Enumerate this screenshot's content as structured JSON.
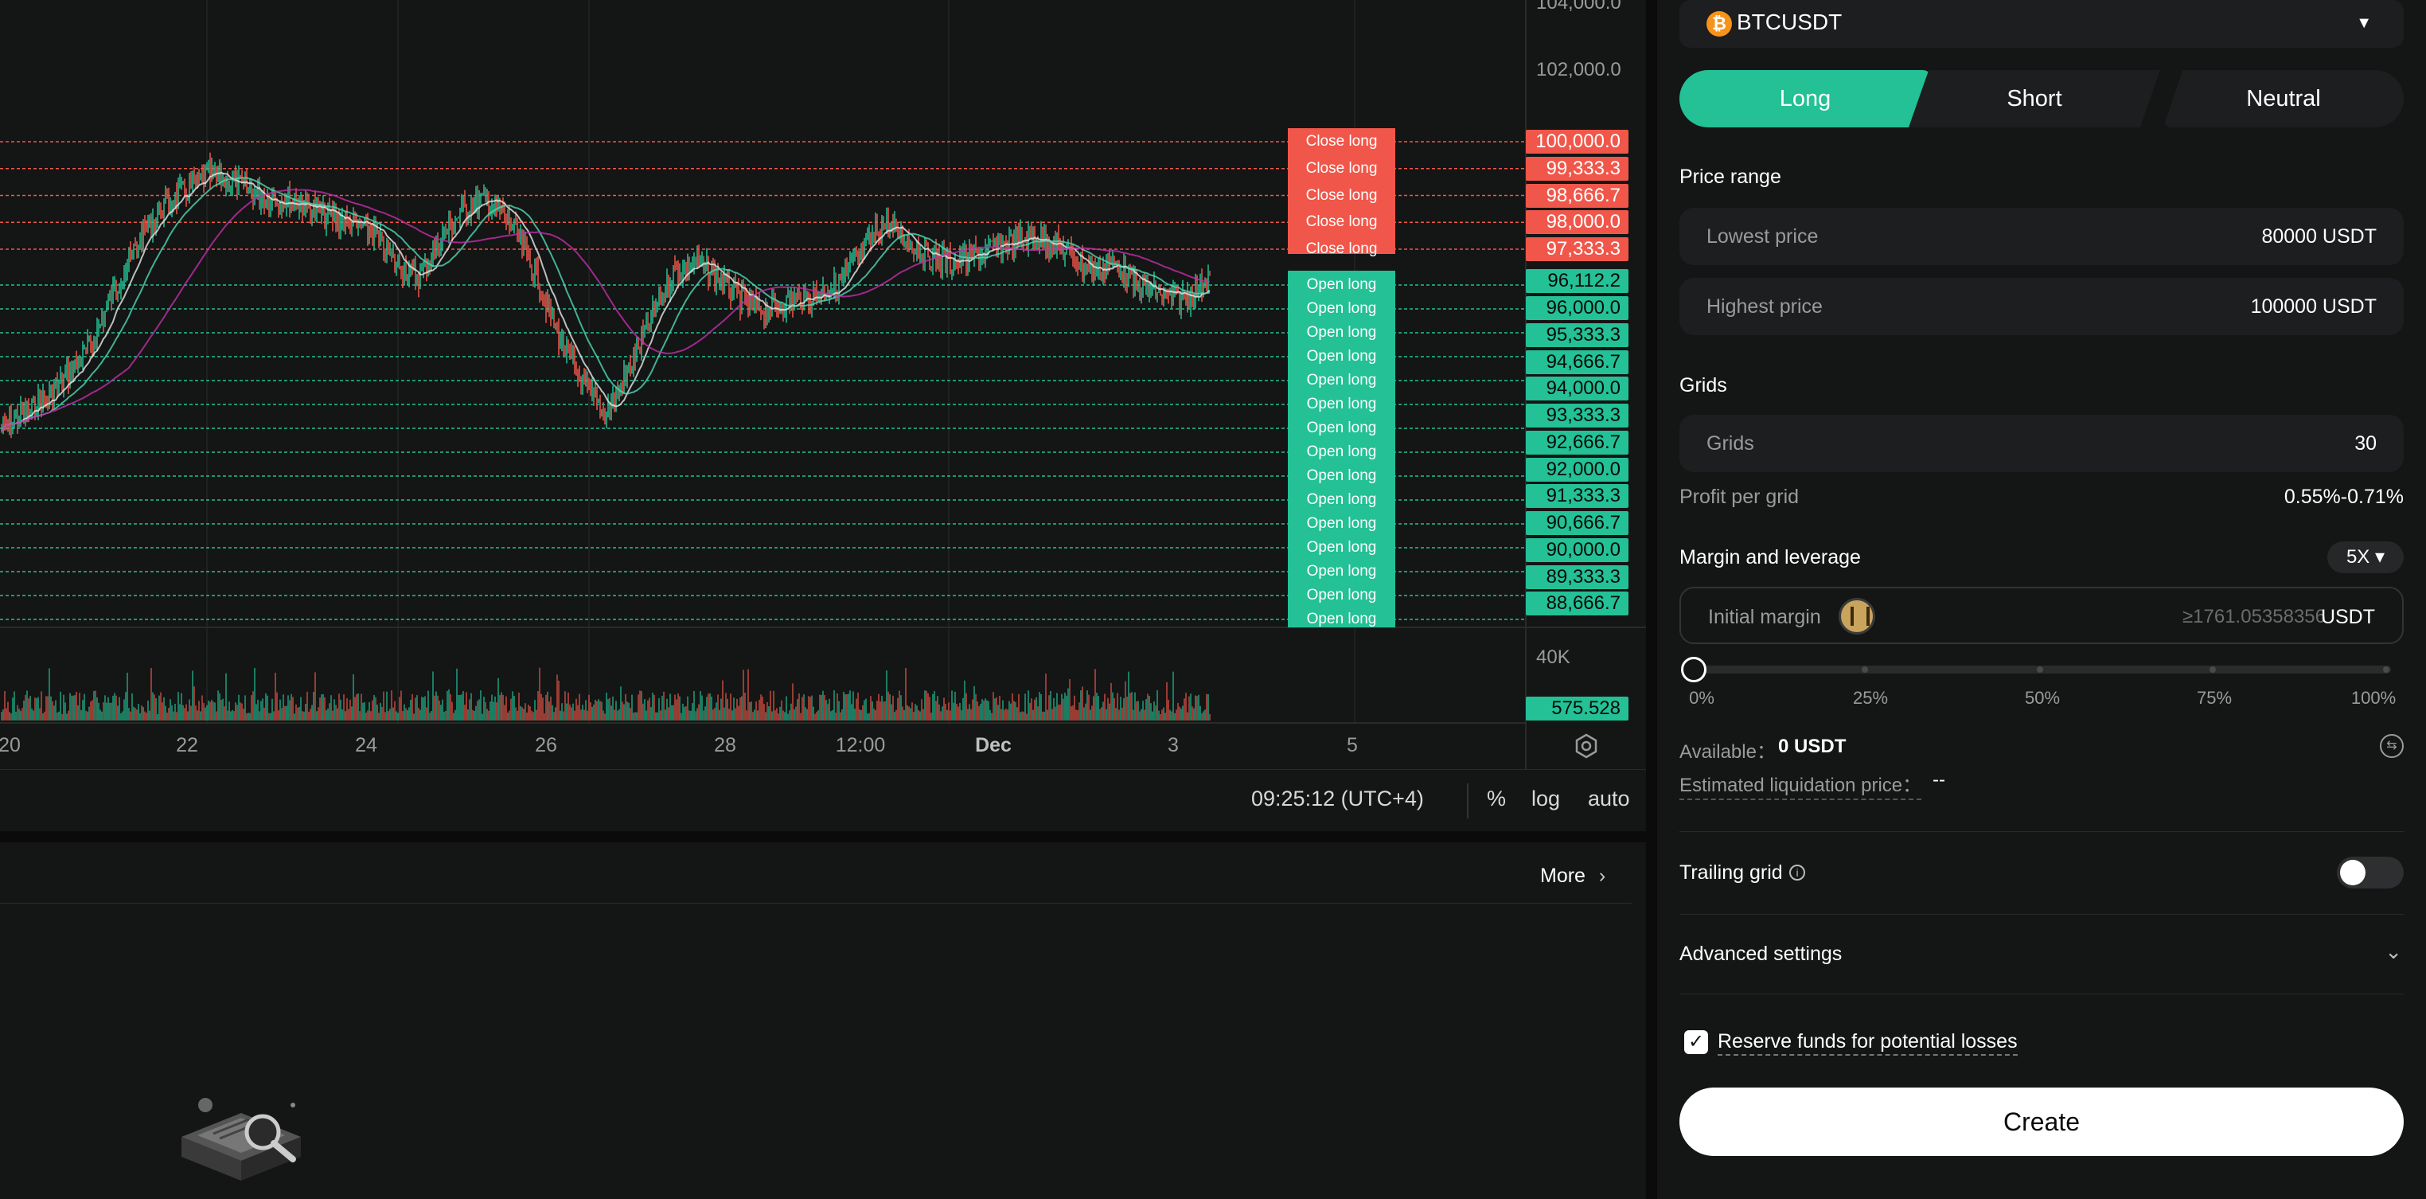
{
  "chart": {
    "price_axis": [
      "104,000.0",
      "102,000.0"
    ],
    "sell_orders": [
      {
        "label": "Close long",
        "price": "100,000.0"
      },
      {
        "label": "Close long",
        "price": "99,333.3"
      },
      {
        "label": "Close long",
        "price": "98,666.7"
      },
      {
        "label": "Close long",
        "price": "98,000.0"
      },
      {
        "label": "Close long",
        "price": "97,333.3"
      }
    ],
    "current_price": "96,112.2",
    "buy_orders": [
      {
        "label": "Open long",
        "price": "96,000.0"
      },
      {
        "label": "Open long",
        "price": "95,333.3"
      },
      {
        "label": "Open long",
        "price": "94,666.7"
      },
      {
        "label": "Open long",
        "price": "94,000.0"
      },
      {
        "label": "Open long",
        "price": "93,333.3"
      },
      {
        "label": "Open long",
        "price": "92,666.7"
      },
      {
        "label": "Open long",
        "price": "92,000.0"
      },
      {
        "label": "Open long",
        "price": "91,333.3"
      },
      {
        "label": "Open long",
        "price": "90,666.7"
      },
      {
        "label": "Open long",
        "price": "90,000.0"
      },
      {
        "label": "Open long",
        "price": "89,333.3"
      },
      {
        "label": "Open long",
        "price": "88,666.7"
      },
      {
        "label": "Open long",
        "price": ""
      },
      {
        "label": "Open long",
        "price": ""
      },
      {
        "label": "Open long",
        "price": ""
      }
    ],
    "volume_axis": "40K",
    "current_volume": "575.528",
    "x_labels": [
      "20",
      "22",
      "24",
      "26",
      "28",
      "12:00",
      "Dec",
      "3",
      "5"
    ],
    "time_readout": "09:25:12 (UTC+4)",
    "axis_options": [
      "%",
      "log",
      "auto"
    ],
    "colors": {
      "up": "#23c195",
      "down": "#f0574a",
      "ma_fast": "#e8e8e8",
      "ma_mid": "#4fd8b4",
      "ma_slow": "#c02fa8"
    }
  },
  "info_panel": {
    "more_label": "More"
  },
  "form": {
    "pair": "BTCUSDT",
    "pair_icon": "₿",
    "tabs": {
      "long": "Long",
      "short": "Short",
      "neutral": "Neutral"
    },
    "price_range": {
      "title": "Price range",
      "lowest_label": "Lowest price",
      "lowest_value": "80000 USDT",
      "highest_label": "Highest price",
      "highest_value": "100000 USDT"
    },
    "grids": {
      "title": "Grids",
      "label": "Grids",
      "value": "30",
      "profit_label": "Profit per grid",
      "profit_value": "0.55%-0.71%"
    },
    "margin": {
      "title": "Margin and leverage",
      "leverage": "5X ▾",
      "initial_label": "Initial margin",
      "placeholder": "≥1761.05358356",
      "unit": "USDT",
      "slider_ticks": [
        "0%",
        "25%",
        "50%",
        "75%",
        "100%"
      ],
      "slider_value": 0
    },
    "available_label": "Available：",
    "available_value": "0 USDT",
    "liquidation_label": "Estimated liquidation price：",
    "liquidation_value": "--",
    "trailing_label": "Trailing grid",
    "advanced_label": "Advanced settings",
    "reserve_label": "Reserve funds for potential losses",
    "create_label": "Create"
  }
}
